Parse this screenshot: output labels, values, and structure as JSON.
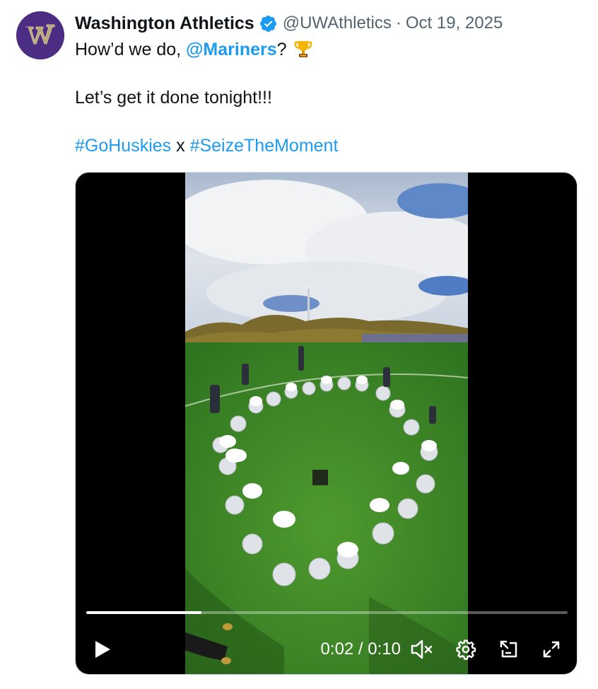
{
  "author": {
    "display_name": "Washington Athletics",
    "handle": "@UWAthletics",
    "separator": "·",
    "date": "Oct 19, 2025",
    "verified": true,
    "avatar_letter": "W",
    "avatar_color": "#4b2e83",
    "avatar_letter_color": "#b7a57a"
  },
  "tweet": {
    "line1_prefix": "How’d we do, ",
    "mention": "@Mariners",
    "line1_suffix": "?",
    "emoji": "trophy-icon",
    "line2": "Let’s get it done tonight!!!",
    "hashtag1": "#GoHuskies",
    "hashtag_joiner": " x ",
    "hashtag2": "#SeizeTheMoment"
  },
  "video": {
    "current_time": "0:02",
    "duration": "0:10",
    "time_separator": " / ",
    "progress_fraction": 0.24,
    "controls": [
      "play-icon",
      "volume-muted-icon",
      "settings-icon",
      "picture-in-picture-icon",
      "fullscreen-icon"
    ]
  },
  "colors": {
    "link": "#1d9bf0",
    "secondary_text": "#536471",
    "verified_badge": "#1d9bf0"
  }
}
